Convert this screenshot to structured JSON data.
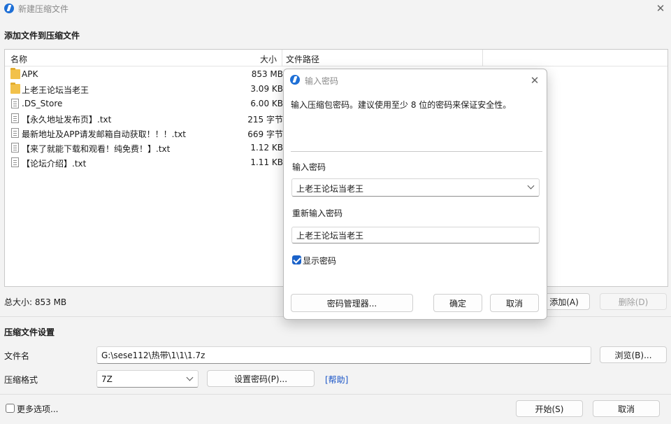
{
  "window": {
    "title": "新建压缩文件",
    "close_glyph": "✕"
  },
  "add_section": {
    "title": "添加文件到压缩文件"
  },
  "file_table": {
    "columns": {
      "name": "名称",
      "size": "大小",
      "path": "文件路径"
    },
    "rows": [
      {
        "name": "APK",
        "size": "853 MB",
        "icon": "folder-icon"
      },
      {
        "name": "上老王论坛当老王",
        "size": "3.09 KB",
        "icon": "folder-icon"
      },
      {
        "name": ".DS_Store",
        "size": "6.00 KB",
        "icon": "document-icon"
      },
      {
        "name": "【永久地址发布页】.txt",
        "size": "215 字节",
        "icon": "document-icon"
      },
      {
        "name": "最新地址及APP请发邮箱自动获取！！！.txt",
        "size": "669 字节",
        "icon": "document-icon"
      },
      {
        "name": "【来了就能下载和观看！纯免费！】.txt",
        "size": "1.12 KB",
        "icon": "document-icon"
      },
      {
        "name": "【论坛介绍】.txt",
        "size": "1.11 KB",
        "icon": "document-icon"
      }
    ]
  },
  "total": {
    "label": "总大小: 853 MB"
  },
  "actions": {
    "add": "添加(A)",
    "delete": "删除(D)"
  },
  "settings": {
    "title": "压缩文件设置",
    "filename_label": "文件名",
    "filename_value": "G:\\sese112\\热带\\1\\1\\1.7z",
    "browse": "浏览(B)...",
    "format_label": "压缩格式",
    "format_value": "7Z",
    "set_password": "设置密码(P)...",
    "help": "[帮助]"
  },
  "footer": {
    "more_options": "更多选项...",
    "start": "开始(S)",
    "cancel": "取消"
  },
  "password_dialog": {
    "title": "输入密码",
    "description": "输入压缩包密码。建议使用至少 8 位的密码来保证安全性。",
    "password_label": "输入密码",
    "password_value": "上老王论坛当老王",
    "reenter_label": "重新输入密码",
    "reenter_value": "上老王论坛当老王",
    "show_password": "显示密码",
    "show_password_checked": true,
    "manager": "密码管理器...",
    "ok": "确定",
    "cancel": "取消"
  },
  "colors": {
    "accent": "#1a62c9",
    "link": "#1a55c7"
  }
}
